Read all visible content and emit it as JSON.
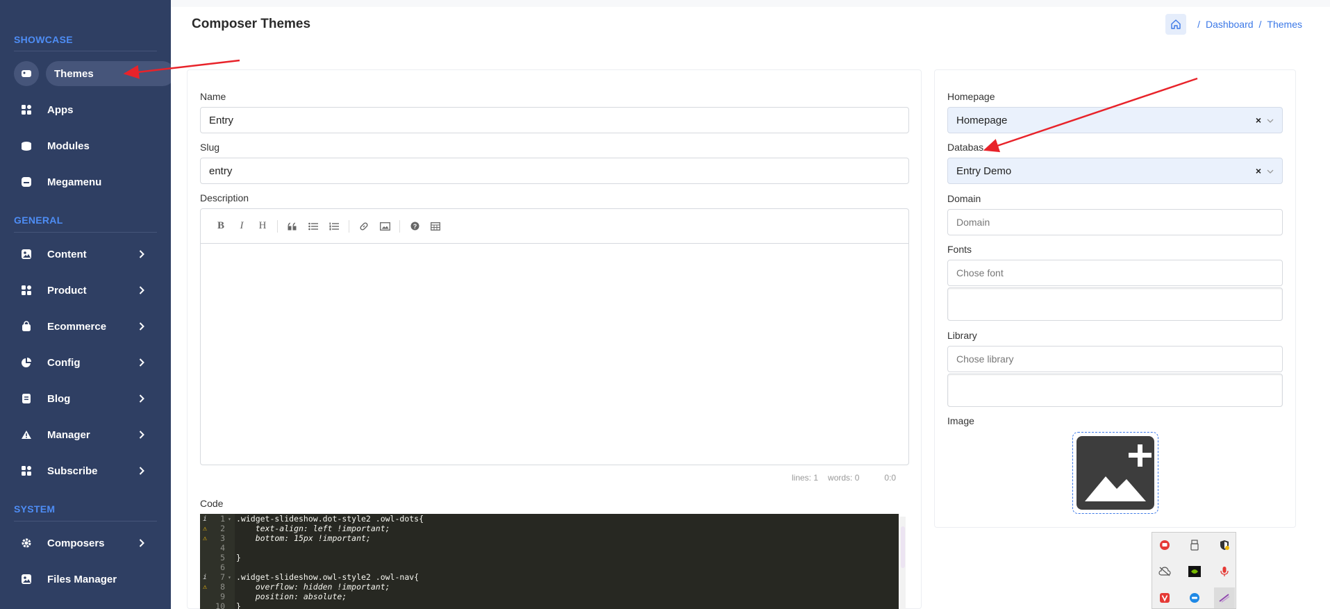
{
  "sidebar": {
    "sections": [
      {
        "title": "SHOWCASE"
      },
      {
        "title": "GENERAL"
      },
      {
        "title": "SYSTEM"
      }
    ],
    "items": [
      {
        "label": "Themes",
        "icon": "theme-icon",
        "active": true,
        "chevron": false
      },
      {
        "label": "Apps",
        "icon": "grid-icon",
        "chevron": false
      },
      {
        "label": "Modules",
        "icon": "modules-icon",
        "chevron": false
      },
      {
        "label": "Megamenu",
        "icon": "menu-icon",
        "chevron": false
      },
      {
        "label": "Content",
        "icon": "image-icon",
        "chevron": true
      },
      {
        "label": "Product",
        "icon": "grid-icon",
        "chevron": true
      },
      {
        "label": "Ecommerce",
        "icon": "bag-icon",
        "chevron": true
      },
      {
        "label": "Config",
        "icon": "pie-icon",
        "chevron": true
      },
      {
        "label": "Blog",
        "icon": "doc-icon",
        "chevron": true
      },
      {
        "label": "Manager",
        "icon": "warning-icon",
        "chevron": true
      },
      {
        "label": "Subscribe",
        "icon": "grid-icon",
        "chevron": true
      },
      {
        "label": "Composers",
        "icon": "gear-icon",
        "chevron": true
      },
      {
        "label": "Files Manager",
        "icon": "image-icon",
        "chevron": false
      }
    ]
  },
  "header": {
    "title": "Composer Themes",
    "breadcrumb": [
      "Dashboard",
      "Themes"
    ]
  },
  "form": {
    "name_label": "Name",
    "name_value": "Entry",
    "slug_label": "Slug",
    "slug_value": "entry",
    "description_label": "Description",
    "editor_status": {
      "lines": "lines: 1",
      "words": "words: 0",
      "cursor": "0:0"
    },
    "code_label": "Code",
    "code_lines": [
      {
        "n": "1",
        "mark": "i",
        "fold": true,
        "text": ".widget-slideshow.dot-style2 .owl-dots{"
      },
      {
        "n": "2",
        "mark": "warn",
        "text": "    text-align: left !important;"
      },
      {
        "n": "3",
        "mark": "warn",
        "text": "    bottom: 15px !important;"
      },
      {
        "n": "4",
        "text": ""
      },
      {
        "n": "5",
        "text": "}"
      },
      {
        "n": "6",
        "text": ""
      },
      {
        "n": "7",
        "mark": "i",
        "fold": true,
        "text": ".widget-slideshow.owl-style2 .owl-nav{"
      },
      {
        "n": "8",
        "mark": "warn",
        "text": "    overflow: hidden !important;"
      },
      {
        "n": "9",
        "text": "    position: absolute;"
      },
      {
        "n": "10",
        "text": "}"
      }
    ]
  },
  "side_form": {
    "homepage_label": "Homepage",
    "homepage_value": "Homepage",
    "database_label": "Databas",
    "database_value": "Entry Demo",
    "domain_label": "Domain",
    "domain_placeholder": "Domain",
    "fonts_label": "Fonts",
    "fonts_placeholder": "Chose font",
    "library_label": "Library",
    "library_placeholder": "Chose library",
    "image_label": "Image",
    "clear_symbol": "×"
  },
  "colors": {
    "sidebar_bg": "#2f3f63",
    "section_title": "#4e8df5",
    "accent": "#3b78e7",
    "arrow": "#e8232a"
  }
}
